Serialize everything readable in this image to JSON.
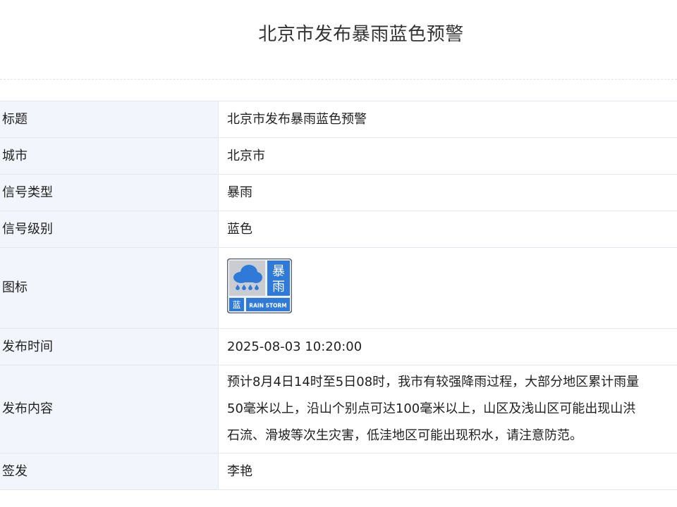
{
  "page": {
    "title": "北京市发布暴雨蓝色预警"
  },
  "rows": {
    "title": {
      "label": "标题",
      "value": "北京市发布暴雨蓝色预警"
    },
    "city": {
      "label": "城市",
      "value": "北京市"
    },
    "signal": {
      "label": "信号类型",
      "value": "暴雨"
    },
    "level": {
      "label": "信号级别",
      "value": "蓝色"
    },
    "icon": {
      "label": "图标",
      "icon_name": "rainstorm-blue-warning-icon",
      "icon_text_top": "暴",
      "icon_text_bottom": "雨",
      "icon_level_char": "蓝",
      "icon_caption": "RAIN STORM"
    },
    "time": {
      "label": "发布时间",
      "value": "2025-08-03 10:20:00"
    },
    "content": {
      "label": "发布内容",
      "lines": [
        "预计8月4日14时至5日08时，我市有较强降雨过程，大部分地区累计雨量",
        "50毫米以上，沿山个别点可达100毫米以上，山区及浅山区可能出现山洪",
        "石流、滑坡等次生灾害，低洼地区可能出现积水，请注意防范。"
      ]
    },
    "issuer": {
      "label": "签发",
      "value": "李艳"
    }
  },
  "colors": {
    "label_bg": "#f2f6fc",
    "border": "#e3e8ef",
    "icon_blue": "#2f7ad9"
  }
}
